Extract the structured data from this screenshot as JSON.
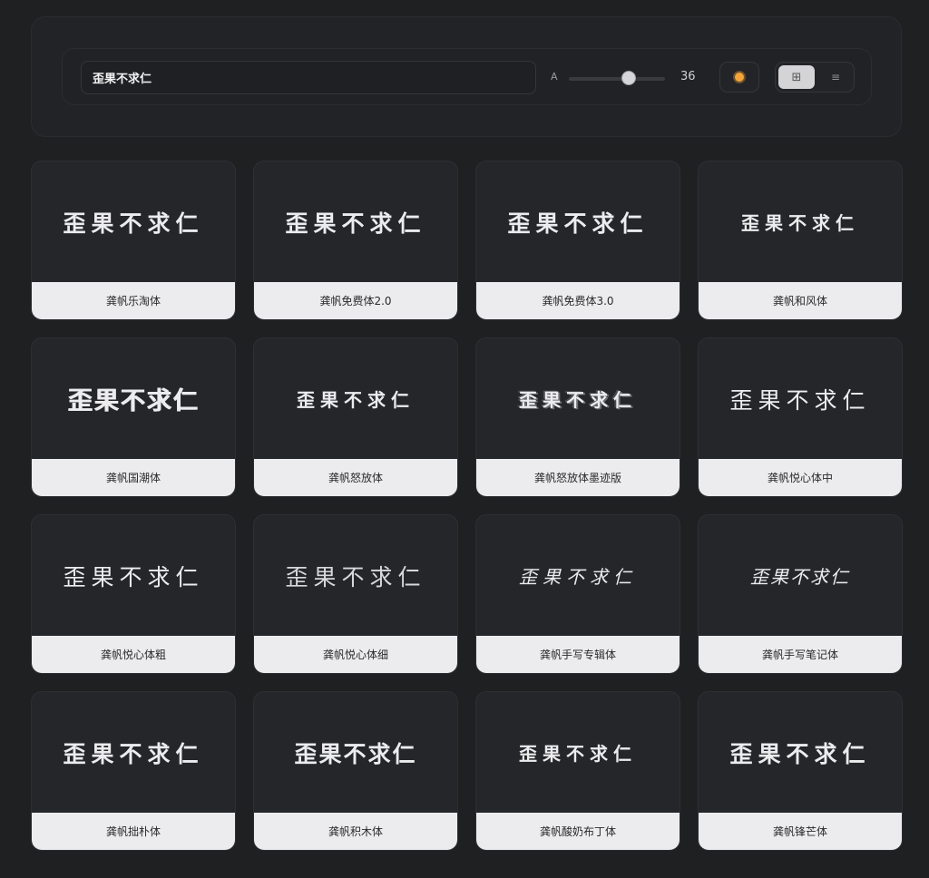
{
  "toolbar": {
    "search_value": "歪果不求仁",
    "size_label": "A",
    "size_value": "36",
    "size_fraction": 0.62,
    "theme_icon": "sun-icon",
    "grid_icon": "⊞",
    "list_icon": "≡"
  },
  "cards": [
    {
      "preview": "歪果不求仁",
      "font_name": "龚帆乐淘体"
    },
    {
      "preview": "歪果不求仁",
      "font_name": "龚帆免费体2.0"
    },
    {
      "preview": "歪果不求仁",
      "font_name": "龚帆免费体3.0"
    },
    {
      "preview": "歪果不求仁",
      "font_name": "龚帆和风体"
    },
    {
      "preview": "歪果不求仁",
      "font_name": "龚帆国潮体"
    },
    {
      "preview": "歪果不求仁",
      "font_name": "龚帆怒放体"
    },
    {
      "preview": "歪果不求仁",
      "font_name": "龚帆怒放体墨迹版"
    },
    {
      "preview": "歪果不求仁",
      "font_name": "龚帆悦心体中"
    },
    {
      "preview": "歪果不求仁",
      "font_name": "龚帆悦心体粗"
    },
    {
      "preview": "歪果不求仁",
      "font_name": "龚帆悦心体细"
    },
    {
      "preview": "歪果不求仁",
      "font_name": "龚帆手写专辑体"
    },
    {
      "preview": "歪果不求仁",
      "font_name": "龚帆手写笔记体"
    },
    {
      "preview": "歪果不求仁",
      "font_name": "龚帆拙朴体"
    },
    {
      "preview": "歪果不求仁",
      "font_name": "龚帆积木体"
    },
    {
      "preview": "歪果不求仁",
      "font_name": "龚帆酸奶布丁体"
    },
    {
      "preview": "歪果不求仁",
      "font_name": "龚帆锋芒体"
    }
  ]
}
